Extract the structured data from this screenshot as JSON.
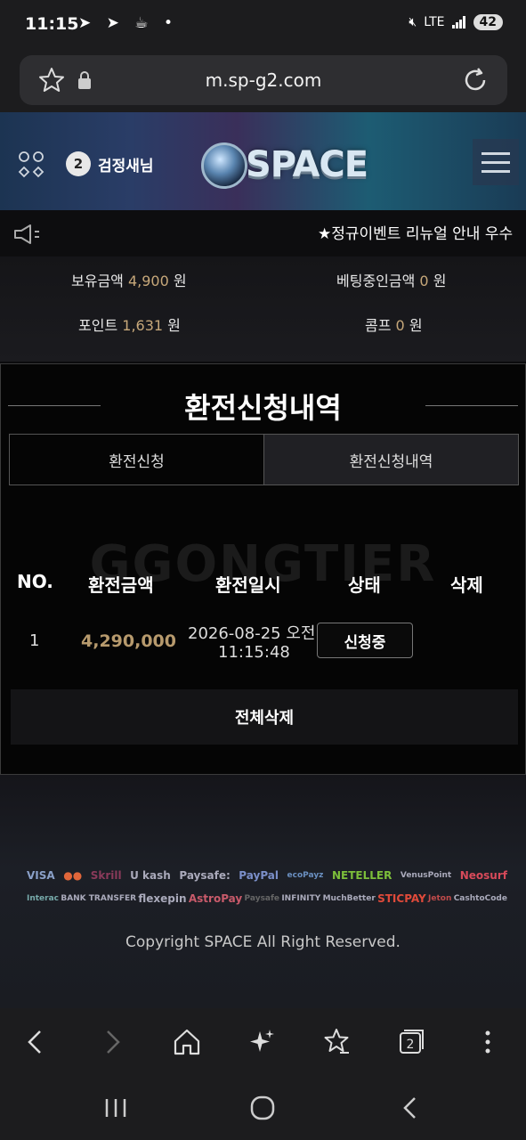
{
  "status_bar": {
    "time": "11:15",
    "left_icons": "➤ ➤ ☕ •",
    "network": "LTE",
    "battery": "42"
  },
  "browser": {
    "url": "m.sp-g2.com"
  },
  "header": {
    "level": "2",
    "username": "검정새님",
    "logo_text": "SPACE"
  },
  "notice": {
    "text": "★정규이벤트 리뉴얼 안내 우수"
  },
  "balance": {
    "holding_label": "보유금액",
    "holding_value": "4,900",
    "betting_label": "베팅중인금액",
    "betting_value": "0",
    "point_label": "포인트",
    "point_value": "1,631",
    "comp_label": "콤프",
    "comp_value": "0",
    "unit": "원"
  },
  "panel": {
    "title": "환전신청내역",
    "tabs": [
      {
        "label": "환전신청"
      },
      {
        "label": "환전신청내역"
      }
    ],
    "watermark": "GGONGTIER",
    "columns": [
      "NO.",
      "환전금액",
      "환전일시",
      "상태",
      "삭제"
    ],
    "rows": [
      {
        "no": "1",
        "amount": "4,290,000",
        "date": "2026-08-25 오전",
        "time": "11:15:48",
        "status": "신청중"
      }
    ],
    "delete_all": "전체삭제"
  },
  "footer": {
    "payments_row1": [
      "VISA",
      "●●",
      "Skrill",
      "U kash",
      "Paysafe:",
      "PayPal",
      "ecoPayz",
      "NETELLER",
      "VenusPoint",
      "Neosurf"
    ],
    "payments_row2": [
      "Interac",
      "BANK TRANSFER",
      "flexepin",
      "AstroPay",
      "Paysafe",
      "INFINITY",
      "MuchBetter",
      "STICPAY",
      "Jeton",
      "CashtoCode"
    ],
    "copyright": "Copyright SPACE All Right Reserved."
  },
  "colors": {
    "accent_gold": "#c7a87a",
    "panel_bg": "#050505"
  }
}
